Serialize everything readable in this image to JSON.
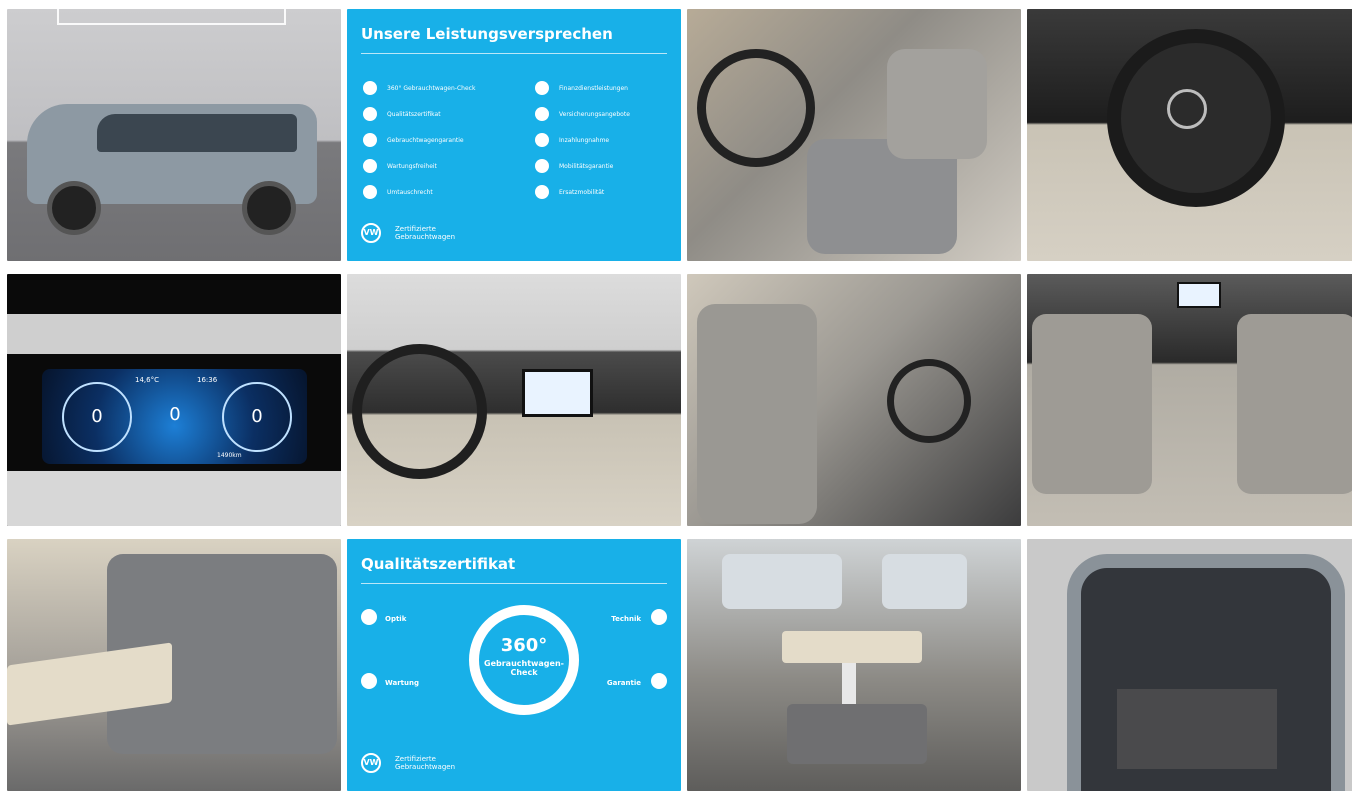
{
  "gallery": {
    "tiles": [
      {
        "kind": "photo",
        "alt": "van-exterior"
      },
      {
        "kind": "promise"
      },
      {
        "kind": "photo",
        "alt": "front-cabin"
      },
      {
        "kind": "photo",
        "alt": "steering-wheel"
      },
      {
        "kind": "photo",
        "alt": "instrument-cluster"
      },
      {
        "kind": "photo",
        "alt": "dashboard"
      },
      {
        "kind": "photo",
        "alt": "passenger-seat"
      },
      {
        "kind": "photo",
        "alt": "rear-view-to-front"
      },
      {
        "kind": "photo",
        "alt": "rear-bench"
      },
      {
        "kind": "certificate"
      },
      {
        "kind": "photo",
        "alt": "luxury-interior"
      },
      {
        "kind": "photo",
        "alt": "trunk-open"
      }
    ]
  },
  "promise": {
    "title": "Unsere Leistungsversprechen",
    "left": [
      "360° Gebrauchtwagen-Check",
      "Qualitätszertifikat",
      "Gebrauchtwagengarantie",
      "Wartungsfreiheit",
      "Umtauschrecht"
    ],
    "right": [
      "Finanzdienstleistungen",
      "Versicherungsangebote",
      "Inzahlungnahme",
      "Mobilitätsgarantie",
      "Ersatzmobilität"
    ],
    "brand_line1": "Zertifizierte",
    "brand_line2": "Gebrauchtwagen"
  },
  "certificate": {
    "title": "Qualitätszertifikat",
    "ring_number": "360°",
    "ring_label": "Gebrauchtwagen-Check",
    "sections": {
      "optik": "Optik",
      "wartung": "Wartung",
      "technik": "Technik",
      "garantie": "Garantie"
    },
    "brand_line1": "Zertifizierte",
    "brand_line2": "Gebrauchtwagen"
  },
  "cluster": {
    "time": "16:36",
    "temp": "14,6°C",
    "speed_left": "0",
    "speed_right": "0",
    "odometer": "1490km"
  },
  "colors": {
    "accent_blue": "#18b0e8",
    "van_body": "#8d99a3"
  }
}
